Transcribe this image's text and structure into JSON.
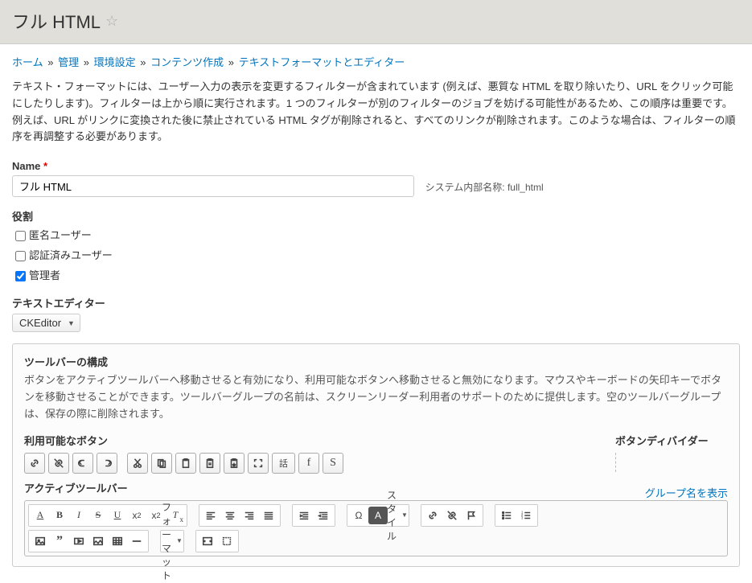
{
  "header": {
    "title": "フル HTML"
  },
  "breadcrumb": {
    "items": [
      "ホーム",
      "管理",
      "環境設定",
      "コンテンツ作成",
      "テキストフォーマットとエディター"
    ],
    "sep": "»"
  },
  "intro": "テキスト・フォーマットには、ユーザー入力の表示を変更するフィルターが含まれています (例えば、悪質な HTML を取り除いたり、URL をクリック可能にしたりします)。フィルターは上から順に実行されます。1 つのフィルターが別のフィルターのジョブを妨げる可能性があるため、この順序は重要です。例えば、URL がリンクに変換された後に禁止されている HTML タグが削除されると、すべてのリンクが削除されます。このような場合は、フィルターの順序を再調整する必要があります。",
  "name": {
    "label": "Name",
    "required": "*",
    "value": "フル HTML",
    "machine_prefix": "システム内部名称:",
    "machine_name": "full_html"
  },
  "roles": {
    "label": "役割",
    "items": [
      {
        "label": "匿名ユーザー",
        "checked": false
      },
      {
        "label": "認証済みユーザー",
        "checked": false
      },
      {
        "label": "管理者",
        "checked": true
      }
    ]
  },
  "editor": {
    "label": "テキストエディター",
    "value": "CKEditor"
  },
  "config": {
    "title": "ツールバーの構成",
    "desc": "ボタンをアクティブツールバーへ移動させると有効になり、利用可能なボタンへ移動させると無効になります。マウスやキーボードの矢印キーでボタンを移動させることができます。ツールバーグループの名前は、スクリーンリーダー利用者のサポートのために提供します。空のツールバーグループは、保存の際に削除されます。",
    "available_label": "利用可能なボタン",
    "divider_label": "ボタンディバイダー",
    "active_label": "アクティブツールバー",
    "show_groups": "グループ名を表示",
    "style_label": "スタイル",
    "format_label": "フォーマット",
    "icons": {
      "available": [
        "link-icon",
        "unlink-icon",
        "undo-icon",
        "redo-icon",
        "cut-icon",
        "copy-icon",
        "paste-icon",
        "paste-text-icon",
        "paste-word-icon",
        "maximize-icon",
        "lang-icon",
        "font-f-icon",
        "font-s-icon"
      ],
      "active_r1_g1": [
        "underline-a-icon",
        "bold-icon",
        "italic-icon",
        "strike-icon",
        "underline-icon",
        "superscript-icon",
        "subscript-icon",
        "removeformat-icon"
      ],
      "active_r1_g2": [
        "align-left-icon",
        "align-center-icon",
        "align-right-icon",
        "align-justify-icon"
      ],
      "active_r1_g3": [
        "indent-right-icon",
        "indent-left-icon"
      ],
      "active_r1_g4": [
        "specialchar-icon",
        "color-bg-icon",
        "style-dropdown"
      ],
      "active_r1_g5": [
        "link2-icon",
        "unlink2-icon",
        "flag-icon"
      ],
      "active_r1_g6": [
        "bullet-list-icon",
        "number-list-icon"
      ],
      "active_r2_g1": [
        "image-icon",
        "quote-icon",
        "media-icon",
        "picture-icon",
        "table-icon",
        "hr-icon"
      ],
      "active_r2_g2": [
        "format-dropdown"
      ],
      "active_r2_g3": [
        "source-icon",
        "fullscreen-icon"
      ]
    }
  }
}
